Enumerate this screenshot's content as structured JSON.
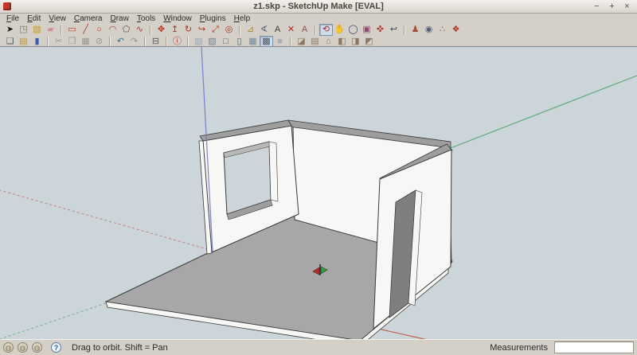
{
  "window": {
    "title": "z1.skp - SketchUp Make [EVAL]",
    "minimize": "−",
    "maximize": "+",
    "close": "×"
  },
  "menu": [
    "File",
    "Edit",
    "View",
    "Camera",
    "Draw",
    "Tools",
    "Window",
    "Plugins",
    "Help"
  ],
  "toolbar_main": {
    "groups": [
      [
        {
          "name": "select-tool",
          "glyph": "➤",
          "color": "#1a1a1a"
        },
        {
          "name": "make-component-tool",
          "glyph": "◳",
          "color": "#776f66"
        },
        {
          "name": "paint-bucket-tool",
          "glyph": "▨",
          "color": "#c09a20"
        },
        {
          "name": "eraser-tool",
          "glyph": "▰",
          "color": "#cf8f9c"
        }
      ],
      [
        {
          "name": "rectangle-tool",
          "glyph": "▭",
          "color": "#a83a30"
        },
        {
          "name": "line-tool",
          "glyph": "╱",
          "color": "#a83a30"
        },
        {
          "name": "circle-tool",
          "glyph": "○",
          "color": "#a83a30"
        },
        {
          "name": "arc-tool",
          "glyph": "◠",
          "color": "#a83a30"
        },
        {
          "name": "polygon-tool",
          "glyph": "⬠",
          "color": "#55504a"
        },
        {
          "name": "freehand-tool",
          "glyph": "∿",
          "color": "#a83a30"
        }
      ],
      [
        {
          "name": "move-tool",
          "glyph": "✥",
          "color": "#b03226"
        },
        {
          "name": "push-pull-tool",
          "glyph": "↥",
          "color": "#b03226"
        },
        {
          "name": "rotate-tool",
          "glyph": "↻",
          "color": "#b03226"
        },
        {
          "name": "follow-me-tool",
          "glyph": "↪",
          "color": "#b03226"
        },
        {
          "name": "scale-tool",
          "glyph": "⤢",
          "color": "#b03226"
        },
        {
          "name": "offset-tool",
          "glyph": "◎",
          "color": "#b03226"
        }
      ],
      [
        {
          "name": "tape-measure-tool",
          "glyph": "⊿",
          "color": "#ab8a1e"
        },
        {
          "name": "protractor-tool",
          "glyph": "∢",
          "color": "#556077"
        },
        {
          "name": "text-tool",
          "glyph": "A",
          "color": "#3a3a3a"
        },
        {
          "name": "axes-tool",
          "glyph": "✕",
          "color": "#b03226"
        },
        {
          "name": "3d-text-tool",
          "glyph": "A",
          "color": "#8d5147"
        }
      ],
      [
        {
          "name": "orbit-tool",
          "glyph": "⟲",
          "color": "#a52f2f",
          "selected": true
        },
        {
          "name": "pan-tool",
          "glyph": "✋",
          "color": "#c89066"
        },
        {
          "name": "zoom-tool",
          "glyph": "◯",
          "color": "#3a4a6a"
        },
        {
          "name": "zoom-window-tool",
          "glyph": "▣",
          "color": "#8a4a6a"
        },
        {
          "name": "zoom-extents-tool",
          "glyph": "✜",
          "color": "#b03226"
        },
        {
          "name": "zoom-previous-tool",
          "glyph": "↩",
          "color": "#3a4a6a"
        }
      ],
      [
        {
          "name": "position-camera-tool",
          "glyph": "♟",
          "color": "#a5503a"
        },
        {
          "name": "look-around-tool",
          "glyph": "◉",
          "color": "#556077"
        },
        {
          "name": "walk-tool",
          "glyph": "∴",
          "color": "#8a6a4a"
        },
        {
          "name": "section-plane-tool",
          "glyph": "❖",
          "color": "#b03226"
        }
      ]
    ]
  },
  "toolbar_standard": {
    "groups": [
      [
        {
          "name": "new-button",
          "glyph": "❏",
          "color": "#4a5668"
        },
        {
          "name": "open-button",
          "glyph": "▤",
          "color": "#bf9626"
        },
        {
          "name": "save-button",
          "glyph": "▮",
          "color": "#3a5ab0"
        }
      ],
      [
        {
          "name": "cut-button",
          "glyph": "✂",
          "color": "#9a968e"
        },
        {
          "name": "copy-button",
          "glyph": "❐",
          "color": "#9a968e"
        },
        {
          "name": "paste-button",
          "glyph": "▦",
          "color": "#9a968e"
        },
        {
          "name": "erase-button",
          "glyph": "⊘",
          "color": "#9a968e"
        }
      ],
      [
        {
          "name": "undo-button",
          "glyph": "↶",
          "color": "#2f7a8a"
        },
        {
          "name": "redo-button",
          "glyph": "↷",
          "color": "#9a968e"
        }
      ],
      [
        {
          "name": "print-button",
          "glyph": "⊟",
          "color": "#5a5a5a"
        }
      ],
      [
        {
          "name": "model-info-button",
          "glyph": "ⓘ",
          "color": "#b02a20"
        }
      ],
      [
        {
          "name": "style-xray-button",
          "glyph": "▧",
          "color": "#8fa8bc"
        },
        {
          "name": "style-back-edges-button",
          "glyph": "▨",
          "color": "#72808e"
        },
        {
          "name": "style-wireframe-button",
          "glyph": "□",
          "color": "#555f66"
        },
        {
          "name": "style-hidden-line-button",
          "glyph": "▯",
          "color": "#555f66"
        },
        {
          "name": "style-shaded-button",
          "glyph": "▦",
          "color": "#7288a0"
        },
        {
          "name": "style-shaded-textures-button",
          "glyph": "▩",
          "color": "#4a5560",
          "selected": true
        },
        {
          "name": "style-monochrome-button",
          "glyph": "■",
          "color": "#a8aeb4"
        }
      ],
      [
        {
          "name": "view-iso-button",
          "glyph": "◪",
          "color": "#8d7560"
        },
        {
          "name": "view-top-button",
          "glyph": "▤",
          "color": "#8d7560"
        },
        {
          "name": "view-front-button",
          "glyph": "⌂",
          "color": "#8d7560"
        },
        {
          "name": "view-right-button",
          "glyph": "◧",
          "color": "#8d7560"
        },
        {
          "name": "view-back-button",
          "glyph": "◨",
          "color": "#8d7560"
        },
        {
          "name": "view-left-button",
          "glyph": "◩",
          "color": "#8d7560"
        }
      ]
    ]
  },
  "viewport": {
    "colors": {
      "sky": "#ccd5da",
      "floor": "#a7a7a7",
      "door_shadow": "#7f7f7f",
      "wall": "#f7f7f6",
      "wall_top": "#9e9e9e",
      "edge": "#3a3a3a",
      "axis_red": "#c06055",
      "axis_green": "#5aaa78",
      "axis_blue": "#7076c8",
      "marker_red": "#b03226",
      "marker_green": "#3a9a3a"
    },
    "model": {
      "description": "3D room model: gray floor slab, back-left wall with square window opening, back-right wall, right wall with door opening, axes origin marker on floor"
    }
  },
  "status_bar": {
    "icons": [
      {
        "name": "geo-location-icon",
        "glyph": "◍"
      },
      {
        "name": "claim-credit-icon",
        "glyph": "◍"
      },
      {
        "name": "sign-in-icon",
        "glyph": "◍"
      }
    ],
    "help_glyph": "?",
    "hint": "Drag to orbit. Shift = Pan",
    "measurements_label": "Measurements",
    "measurements_value": ""
  }
}
